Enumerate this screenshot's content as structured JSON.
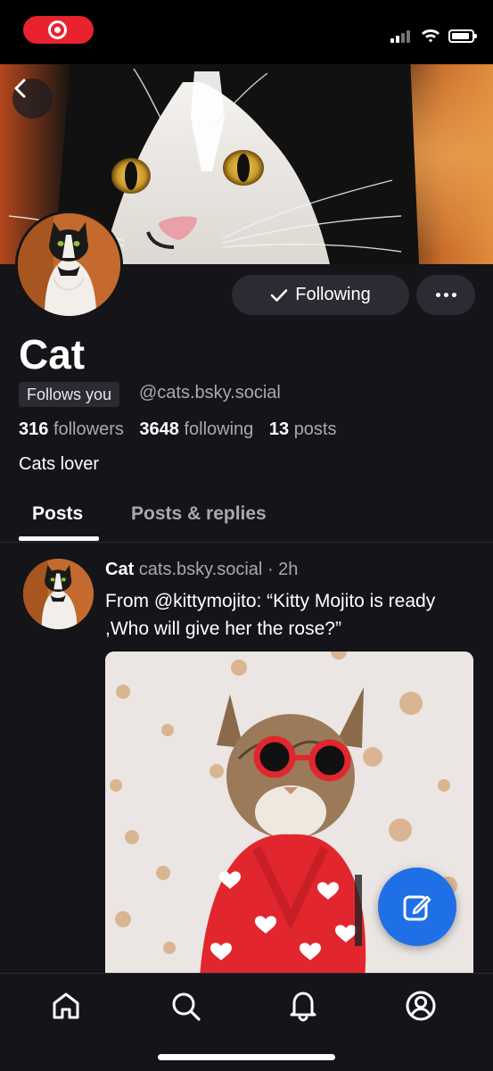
{
  "status_bar": {
    "recording_indicator": "record-icon",
    "icons": [
      "signal-icon",
      "wifi-icon",
      "battery-icon"
    ]
  },
  "profile": {
    "back_icon": "chevron-left-icon",
    "display_name": "Cat",
    "follows_you_label": "Follows you",
    "handle": "@cats.bsky.social",
    "followers_count": "316",
    "followers_label": "followers",
    "following_count": "3648",
    "following_label": "following",
    "posts_count": "13",
    "posts_label": "posts",
    "bio": "Cats lover",
    "following_button_label": "Following",
    "following_button_icon": "check-icon",
    "more_button_icon": "ellipsis-icon"
  },
  "tabs": [
    {
      "label": "Posts",
      "active": true
    },
    {
      "label": "Posts & replies",
      "active": false
    }
  ],
  "post": {
    "author": "Cat",
    "handle": "cats.bsky.social",
    "separator": "·",
    "time": "2h",
    "text": "From @kittymojito: “Kitty Mojito is ready ,Who will give her the rose?”"
  },
  "fab": {
    "icon": "compose-icon"
  },
  "bottom_nav": [
    "home-icon",
    "search-icon",
    "notifications-icon",
    "profile-icon"
  ],
  "colors": {
    "background": "#141419",
    "muted_text": "#a8a8b3",
    "button_bg": "#2b2b33",
    "accent": "#1f6fe6",
    "record": "#e8232f"
  }
}
